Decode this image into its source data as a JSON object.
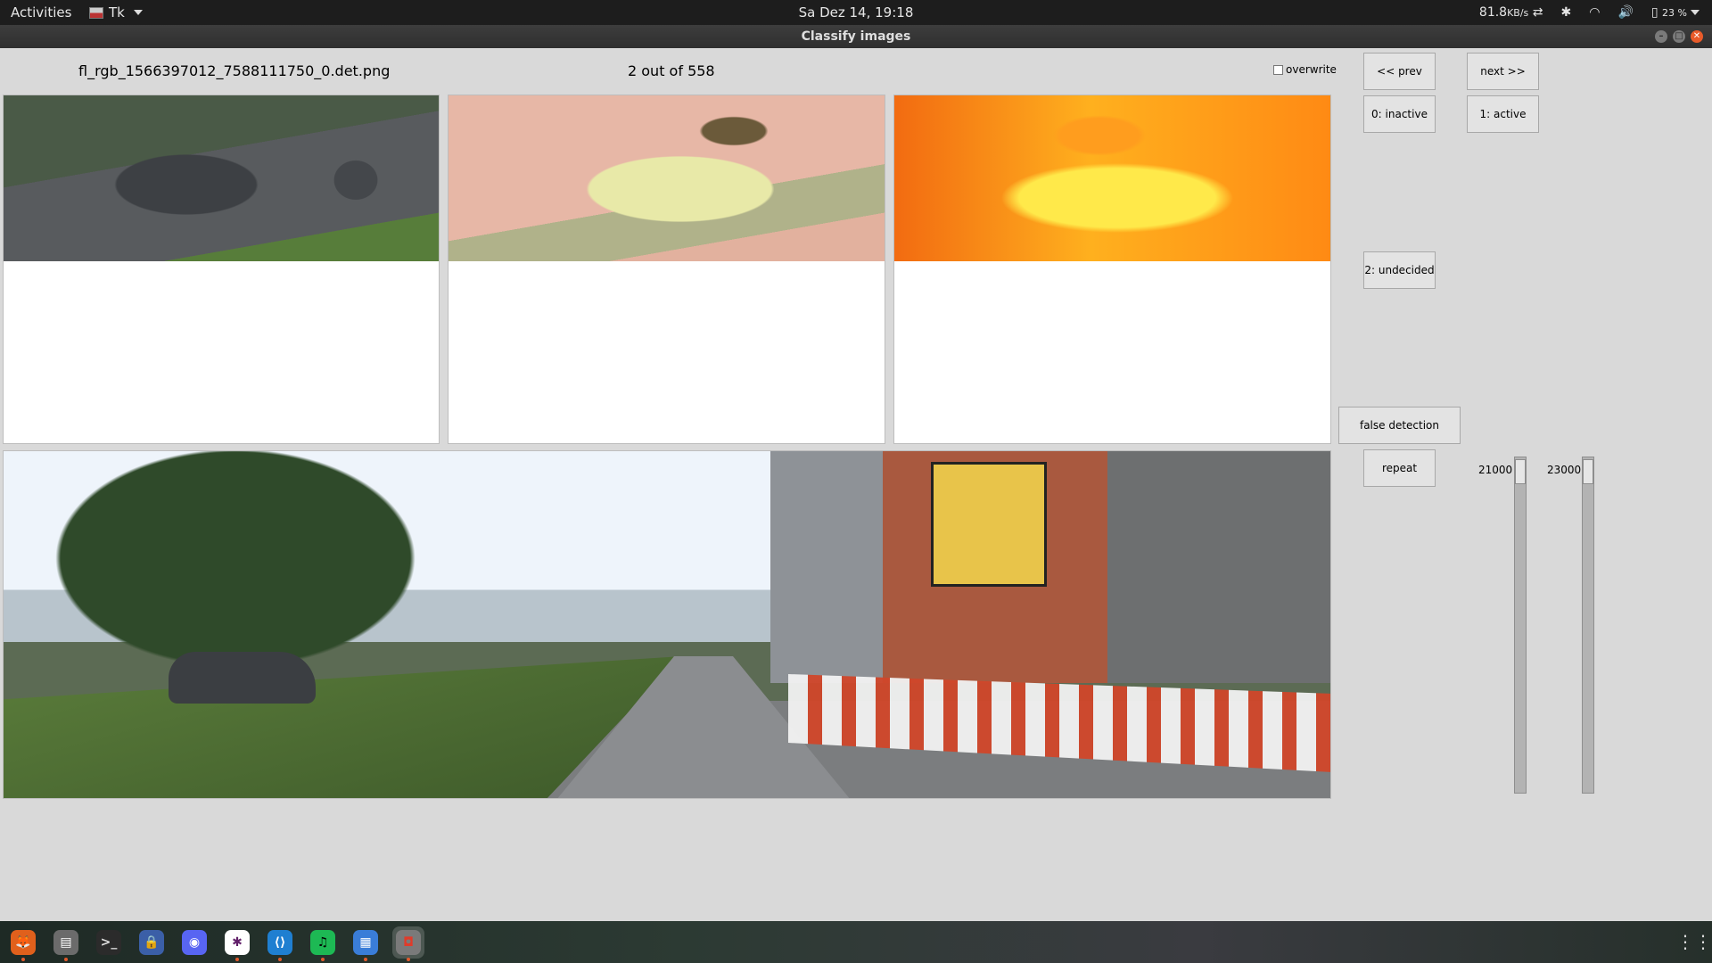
{
  "topbar": {
    "activities": "Activities",
    "app_name": "Tk",
    "clock": "Sa Dez 14, 19:18",
    "net_speed": "81.8",
    "net_unit": "KB/s",
    "battery": "23 %"
  },
  "window": {
    "title": "Classify images"
  },
  "header": {
    "filename": "fl_rgb_1566397012_7588111750_0.det.png",
    "counter": "2 out of 558",
    "overwrite_label": "overwrite",
    "overwrite_checked": false
  },
  "buttons": {
    "prev": "<< prev",
    "next": "next >>",
    "inactive": "0: inactive",
    "active": "1: active",
    "undecided": "2: undecided",
    "false_detection": "false detection",
    "repeat": "repeat"
  },
  "sliders": {
    "left_value": "21000",
    "right_value": "23000"
  },
  "dock": {
    "apps": [
      "firefox-icon",
      "files-icon",
      "terminal-icon",
      "keepass-icon",
      "discord-icon",
      "slack-icon",
      "vscode-icon",
      "spotify-icon",
      "text-editor-icon",
      "tk-app-icon"
    ],
    "glyphs": [
      "🦊",
      "▤",
      ">_",
      "🔒",
      "◉",
      "✱",
      "⟨⟩",
      "♫",
      "▦",
      "◘"
    ]
  },
  "colors": {
    "dock_accent": "#e25a2c",
    "window_close": "#e85b2a"
  }
}
